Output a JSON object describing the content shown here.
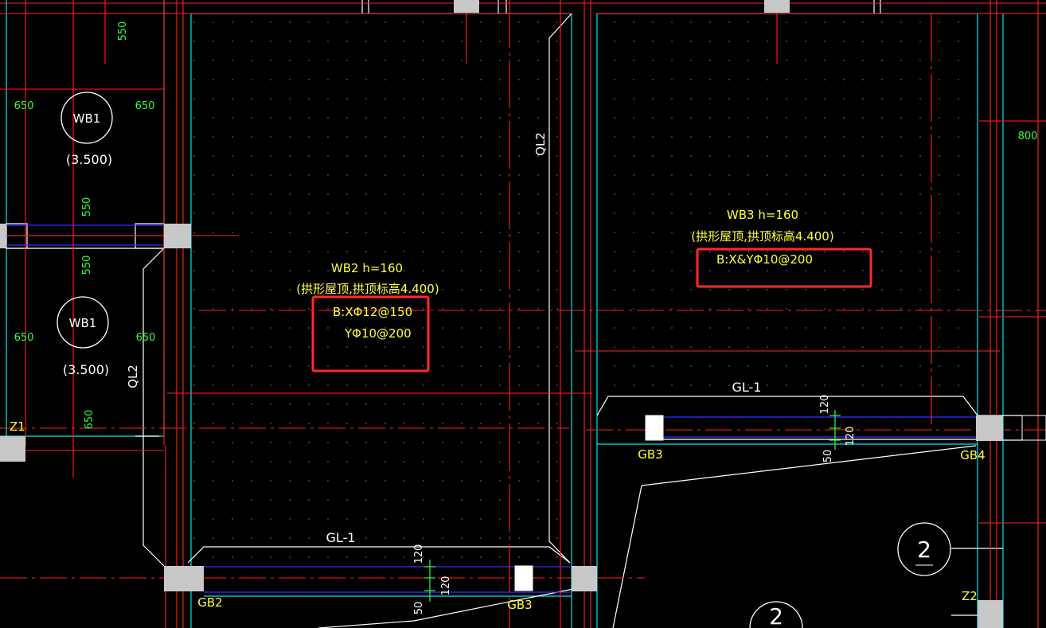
{
  "colors": {
    "background": "#000000",
    "axis": "#ff2020",
    "wall": "#00e5ee",
    "outline": "#ffffff",
    "label": "#ffff33",
    "dimension": "#33ff33",
    "rebar": "#3030ff",
    "highlight": "#ff2a2a",
    "column": "#c8c8c8"
  },
  "slabs": [
    {
      "id": "wb1-top",
      "name": "WB1",
      "elevation": "(3.500)"
    },
    {
      "id": "wb1-bottom",
      "name": "WB1",
      "elevation": "(3.500)"
    }
  ],
  "wb2": {
    "title": "WB2  h=160",
    "note": "(拱形屋顶,拱顶标高4.400)",
    "rebar_x": "B:XΦ12@150",
    "rebar_y": "YΦ10@200"
  },
  "wb3": {
    "title": "WB3  h=160",
    "note": "(拱形屋顶,拱顶标高4.400)",
    "rebar": "B:X&YΦ10@200"
  },
  "beams": {
    "ql2_left": "QL2",
    "ql2_mid": "QL2",
    "gl1_bottom": "GL-1",
    "gl1_right": "GL-1"
  },
  "tags": {
    "gb2": "GB2",
    "gb3_bottom": "GB3",
    "gb3_right": "GB3",
    "gb4": "GB4",
    "z1": "Z1",
    "z2": "Z2"
  },
  "dimensions": {
    "d550_top": "550",
    "d550_a": "550",
    "d550_b": "550",
    "d650_tl": "650",
    "d650_tr": "650",
    "d650_bl": "650",
    "d650_br": "650",
    "d650_v": "650",
    "d800": "800",
    "d120_r1": "120",
    "d120_r2": "120",
    "d50_r": "50",
    "d120_b1": "120",
    "d120_b2": "120",
    "d50_b": "50"
  },
  "axis_markers": {
    "a2_right": "2",
    "a2_bottom": "2"
  }
}
